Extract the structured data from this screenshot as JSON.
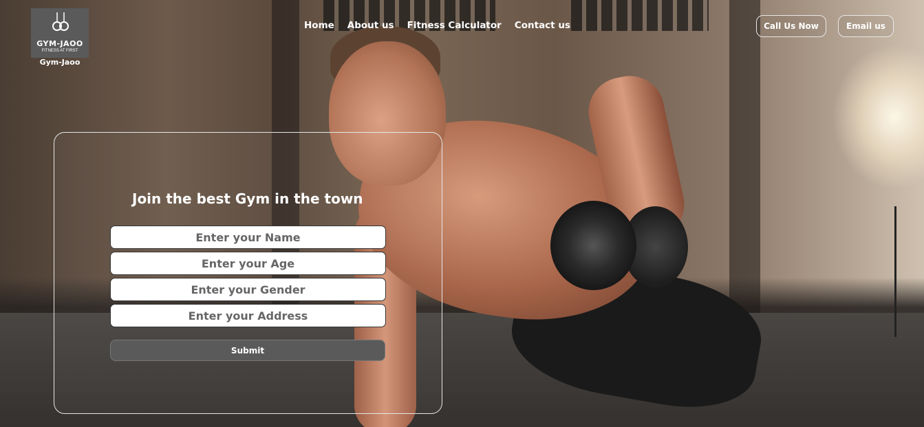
{
  "brand": {
    "logo_title": "GYM-JAOO",
    "logo_tagline": "FITNESS AT FIRST",
    "name": "Gym-Jaoo"
  },
  "nav": {
    "items": [
      {
        "label": "Home"
      },
      {
        "label": "About us"
      },
      {
        "label": "Fitness Calculator"
      },
      {
        "label": "Contact us"
      }
    ]
  },
  "header_buttons": {
    "call": "Call Us Now",
    "email": "Email us"
  },
  "form": {
    "title": "Join the best Gym in the town",
    "name_placeholder": "Enter your Name",
    "age_placeholder": "Enter your Age",
    "gender_placeholder": "Enter your Gender",
    "address_placeholder": "Enter your Address",
    "submit_label": "Submit"
  },
  "colors": {
    "button_gray": "#5a5a5a",
    "border_light": "#e8e8e8"
  }
}
